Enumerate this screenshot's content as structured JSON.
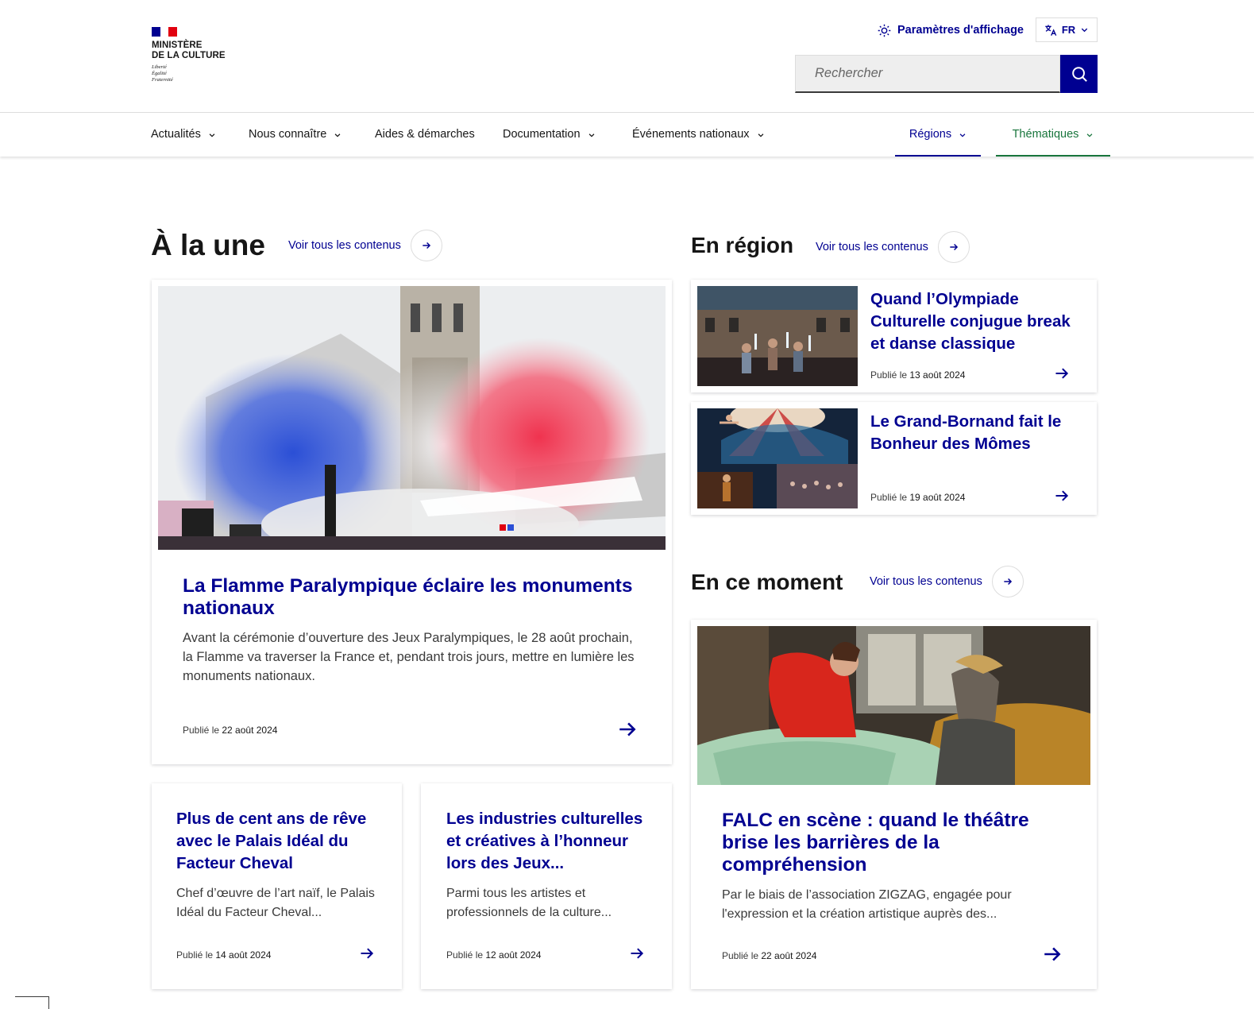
{
  "header": {
    "logo_line1": "MINISTÈRE",
    "logo_line2": "DE LA CULTURE",
    "motto1": "Liberté",
    "motto2": "Égalité",
    "motto3": "Fraternité",
    "display_settings": "Paramètres d'affichage",
    "language": "FR",
    "search_placeholder": "Rechercher"
  },
  "nav": {
    "items": [
      {
        "label": "Actualités"
      },
      {
        "label": "Nous connaître"
      },
      {
        "label": "Aides & démarches"
      },
      {
        "label": "Documentation"
      },
      {
        "label": "Événements nationaux"
      },
      {
        "label": "Régions"
      },
      {
        "label": "Thématiques"
      }
    ]
  },
  "sections": {
    "une": {
      "title": "À la une",
      "see_all": "Voir tous les contenus"
    },
    "region": {
      "title": "En région",
      "see_all": "Voir tous les contenus"
    },
    "moment": {
      "title": "En ce moment",
      "see_all": "Voir tous les contenus"
    }
  },
  "publie": "Publié le",
  "featured": {
    "title": "La Flamme Paralympique éclaire les monuments nationaux",
    "desc": "Avant la cérémonie d’ouverture des Jeux Paralympiques, le 28 août prochain, la Flamme va traverser la France et, pendant trois jours, mettre en lumière les monuments nationaux.",
    "date": "22 août 2024"
  },
  "small_cards": [
    {
      "title": "Plus de cent ans de rêve avec le Palais Idéal du Facteur Cheval",
      "desc": "Chef d’œuvre de l’art naïf, le Palais Idéal du Facteur Cheval...",
      "date": "14 août 2024"
    },
    {
      "title": "Les industries culturelles et créatives à l’honneur lors des Jeux...",
      "desc": "Parmi tous les artistes et professionnels de la culture...",
      "date": "12 août 2024"
    }
  ],
  "region_cards": [
    {
      "title": "Quand l’Olympiade Culturelle conjugue break et danse classique",
      "date": "13 août 2024"
    },
    {
      "title": "Le Grand-Bornand fait le Bonheur des Mômes",
      "date": "19 août 2024"
    }
  ],
  "moment_card": {
    "title": "FALC en scène : quand le théâtre brise les barrières de la compréhension",
    "desc": "Par le biais de l’association ZIGZAG, engagée pour l'expression et la création artistique auprès des...",
    "date": "22 août 2024"
  },
  "colors": {
    "primary": "#000091",
    "green": "#18753c",
    "flag_red": "#e1000f"
  }
}
